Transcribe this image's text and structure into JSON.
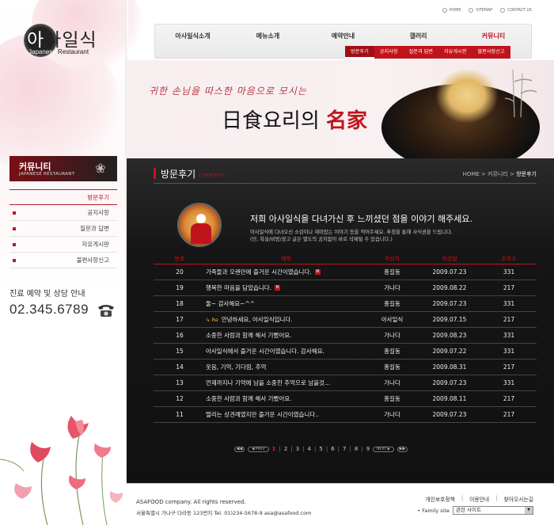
{
  "utility": {
    "home": "HOME",
    "sitemap": "SITEMAP",
    "contact": "CONTACT US"
  },
  "logo": {
    "korean": "아사일식",
    "english": "Japanese Restaurant"
  },
  "gnb": {
    "main": [
      "아사일식소개",
      "메뉴소개",
      "예약안내",
      "갤러리",
      "커뮤니티"
    ],
    "active_index": 4,
    "sub": [
      "방문후기",
      "공지사항",
      "질문과 답변",
      "자유게시판",
      "불편사항신고"
    ],
    "sub_active_index": 0
  },
  "visual": {
    "slogan": "귀한 손님을 따스한 마음으로 모시는",
    "title_prefix": "日食요리의 ",
    "title_emphasis": "名家"
  },
  "sidebar": {
    "section_title": "커뮤니티",
    "section_subtitle": "JAPANESE RESTAURANT",
    "items": [
      "방문후기",
      "공지사항",
      "질문과 답변",
      "자유게시판",
      "불편사항신고"
    ],
    "active_index": 0,
    "contact_label": "진료 예약 및 상담 안내",
    "contact_number": "02.345.6789"
  },
  "content": {
    "title": "방문후기",
    "subtitle": "COMMUNITY",
    "breadcrumb": {
      "home": "HOME",
      "sep": " > ",
      "parent": "커뮤니티",
      "current": "방문후기"
    },
    "intro_head": "저희 아사일식을 다녀가신 후 느끼셨던 점을 이야기 해주세요.",
    "intro_line1": "아사일식에 다녀오신 소감이나 재미있는 이야기 등을 적어주세요. 추첨을 통해 사식권을 드립니다.",
    "intro_line2": "(단, 욕설/비방/광고 글은 별도의 공지없이 바로 삭제될 수 있습니다.)"
  },
  "board": {
    "columns": [
      "번호",
      "제목",
      "작성자",
      "작성일",
      "조회수"
    ],
    "rows": [
      {
        "no": "20",
        "title": "가족들과 오랜만에 즐거운 시간이였습니다.",
        "new": true,
        "re": false,
        "writer": "홍길동",
        "date": "2009.07.23",
        "views": "331"
      },
      {
        "no": "19",
        "title": "행복한 마음을 담았습니다.",
        "new": true,
        "re": false,
        "writer": "가나다",
        "date": "2009.08.22",
        "views": "217"
      },
      {
        "no": "18",
        "title": "둘~ 감사해요~^^",
        "new": false,
        "re": false,
        "writer": "홍길동",
        "date": "2009.07.23",
        "views": "331"
      },
      {
        "no": "17",
        "title": "안녕하세요, 아사일식입니다.",
        "new": false,
        "re": true,
        "re_label": "Re",
        "writer": "아사일식",
        "date": "2009.07.15",
        "views": "217"
      },
      {
        "no": "16",
        "title": "소중한 사람과 함께 해서 기뻤어요.",
        "new": false,
        "re": false,
        "writer": "가나다",
        "date": "2009.08.23",
        "views": "331"
      },
      {
        "no": "15",
        "title": "아사일식에서 즐거운 시간이였습니다. 감사해요.",
        "new": false,
        "re": false,
        "writer": "홍길동",
        "date": "2009.07.22",
        "views": "331"
      },
      {
        "no": "14",
        "title": "웃음, 기억, 기다림, 추억",
        "new": false,
        "re": false,
        "writer": "홍길동",
        "date": "2009.08.31",
        "views": "217"
      },
      {
        "no": "13",
        "title": "언제까지나 기억에 남을 소중한 추억으로 남을것...",
        "new": false,
        "re": false,
        "writer": "가나다",
        "date": "2009.07.23",
        "views": "331"
      },
      {
        "no": "12",
        "title": "소중한 사람과 함께 해서 기뻤어요.",
        "new": false,
        "re": false,
        "writer": "홍길동",
        "date": "2009.08.11",
        "views": "217"
      },
      {
        "no": "11",
        "title": "떨리는 상견례였지만 즐거운 시간이였습니다..",
        "new": false,
        "re": false,
        "writer": "가나다",
        "date": "2009.07.23",
        "views": "217"
      }
    ]
  },
  "pager": {
    "prev": "PREV",
    "next": "NEXT",
    "pages": [
      "1",
      "2",
      "3",
      "4",
      "5",
      "6",
      "7",
      "8",
      "9"
    ],
    "current": "1"
  },
  "footer": {
    "copyright": "ASAFOOD company. All rights reserved.",
    "address": "서울특별시 가나구 다라동 123번지 Tel. 01)234-5678-9 asa@asafood.com",
    "links": [
      "개인보호정책",
      "이용안내",
      "찾아오시는길"
    ],
    "family_label": "• Family site",
    "family_value": "관련 사이트"
  },
  "colors": {
    "accent": "#c0141c",
    "dark": "#151515"
  }
}
